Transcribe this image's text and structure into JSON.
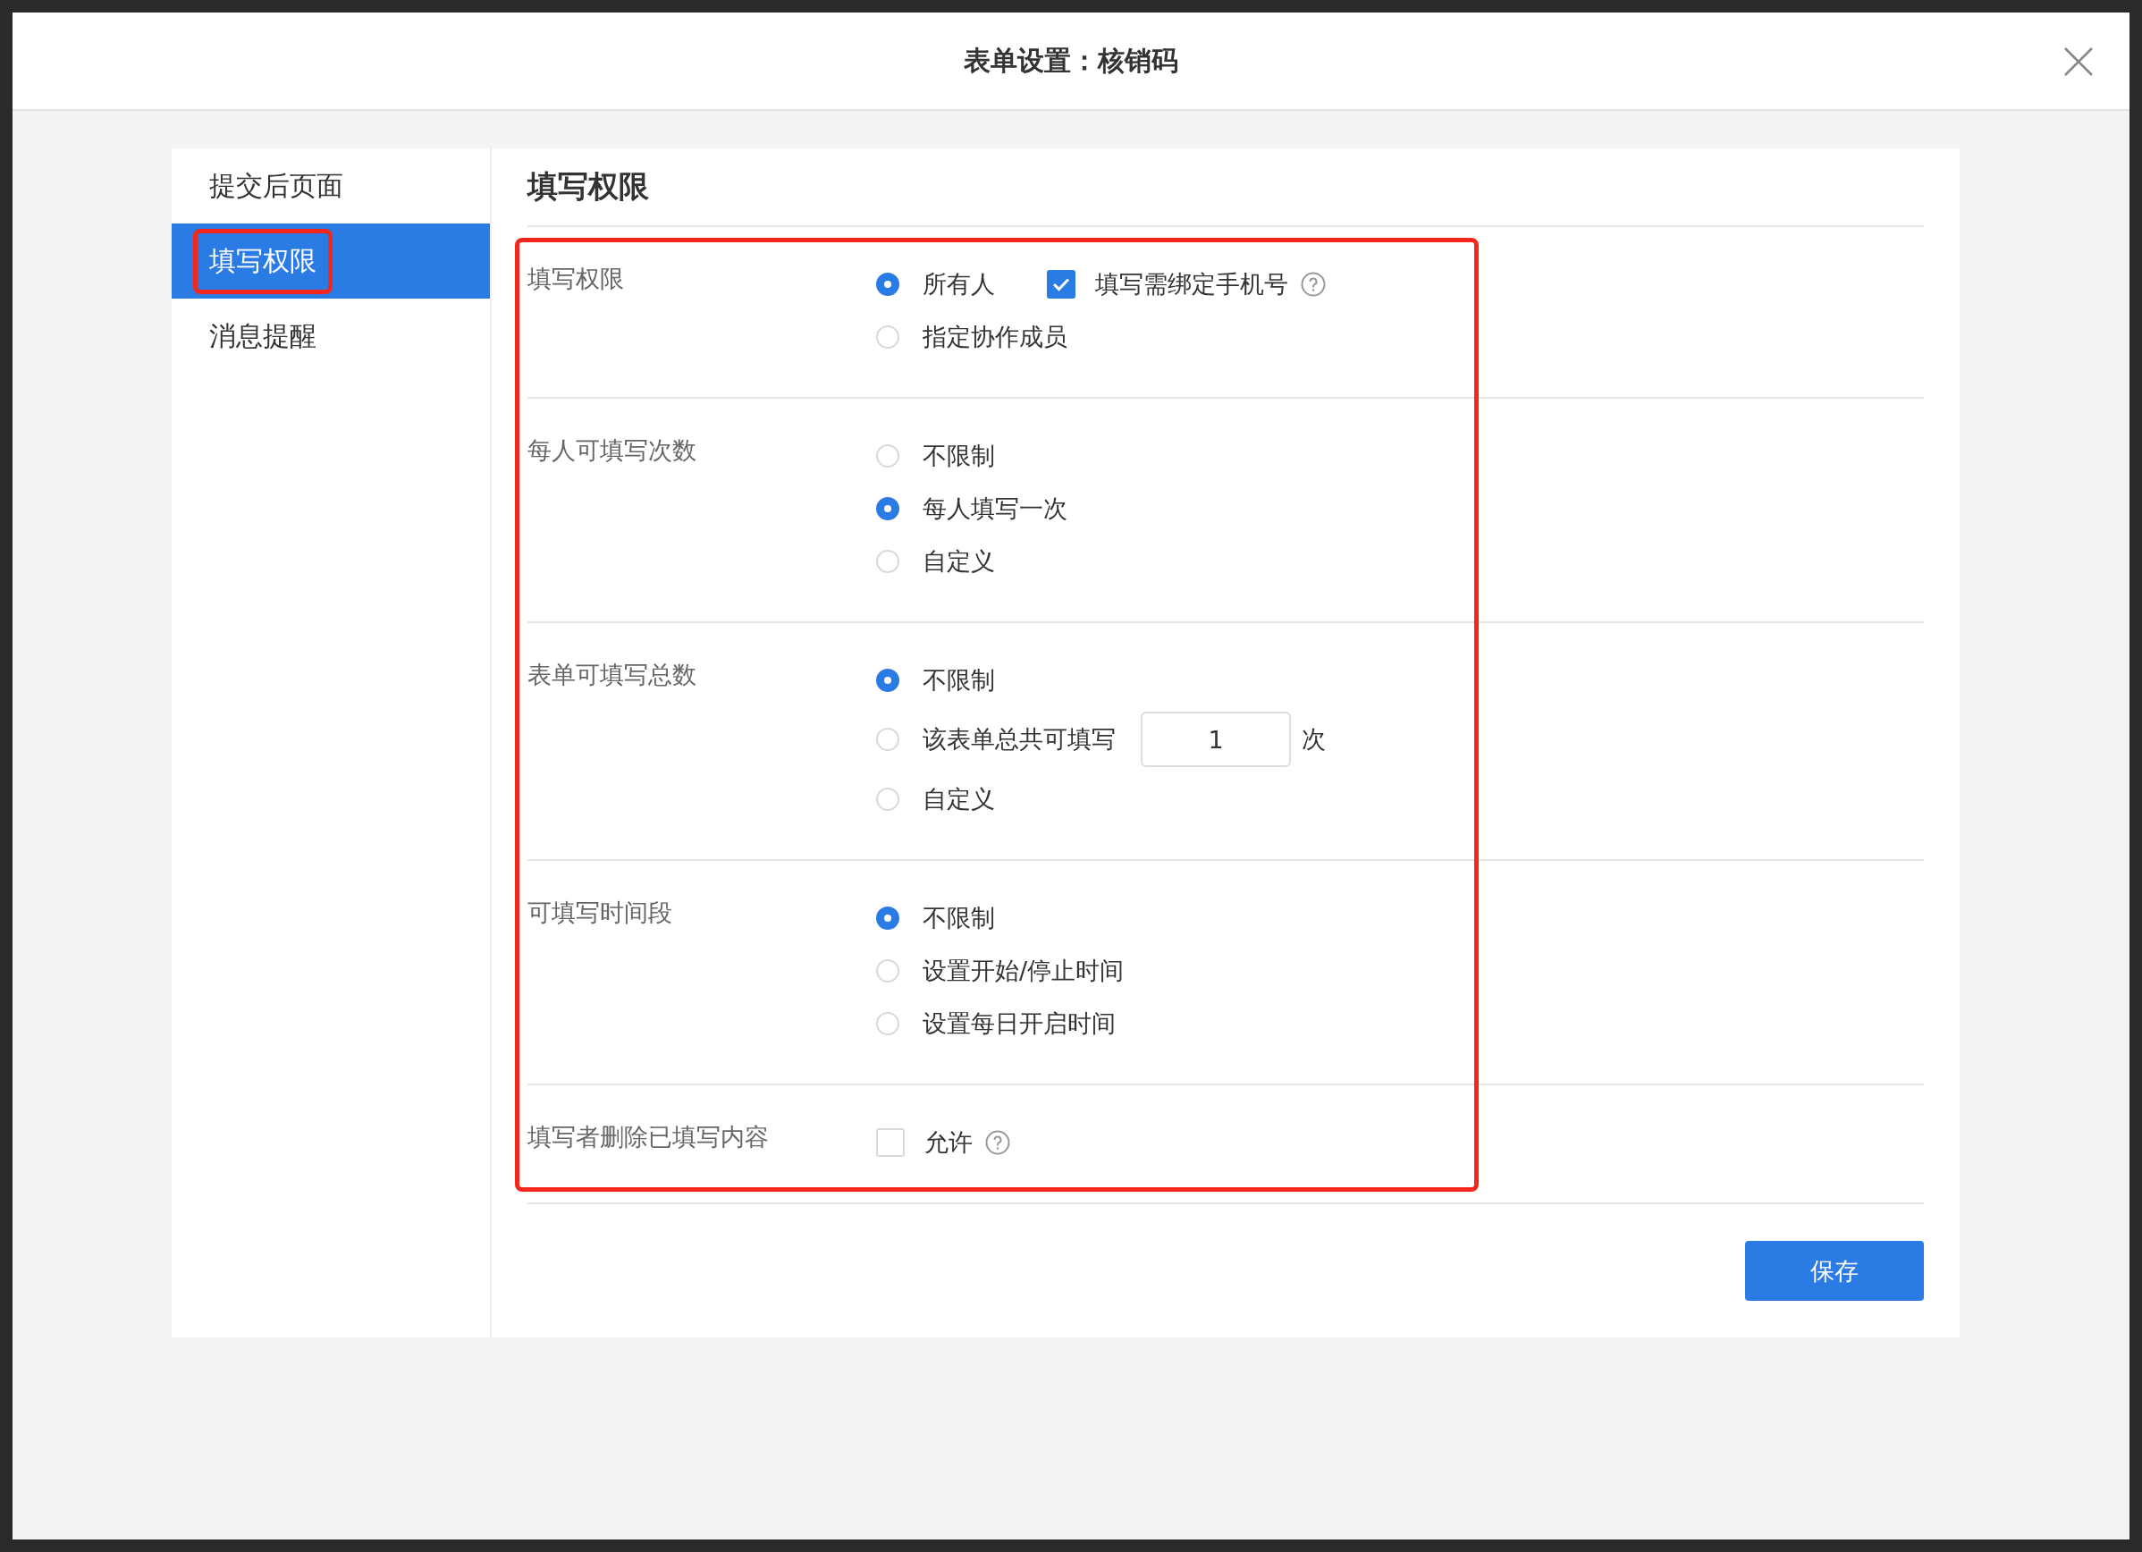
{
  "dialog": {
    "title": "表单设置：核销码"
  },
  "sidebar": {
    "items": [
      {
        "label": "提交后页面",
        "selected": false,
        "highlighted": false
      },
      {
        "label": "填写权限",
        "selected": true,
        "highlighted": true
      },
      {
        "label": "消息提醒",
        "selected": false,
        "highlighted": false
      }
    ]
  },
  "panel": {
    "title": "填写权限",
    "highlighted": true,
    "sections": [
      {
        "label": "填写权限",
        "rows": [
          [
            {
              "kind": "radio",
              "label": "所有人",
              "selected": true
            },
            {
              "kind": "checkbox",
              "label": "填写需绑定手机号",
              "checked": true,
              "help": true
            }
          ],
          [
            {
              "kind": "radio",
              "label": "指定协作成员",
              "selected": false
            }
          ]
        ]
      },
      {
        "label": "每人可填写次数",
        "rows": [
          [
            {
              "kind": "radio",
              "label": "不限制",
              "selected": false
            }
          ],
          [
            {
              "kind": "radio",
              "label": "每人填写一次",
              "selected": true
            }
          ],
          [
            {
              "kind": "radio",
              "label": "自定义",
              "selected": false
            }
          ]
        ]
      },
      {
        "label": "表单可填写总数",
        "rows": [
          [
            {
              "kind": "radio",
              "label": "不限制",
              "selected": true
            }
          ],
          [
            {
              "kind": "radio",
              "label": "该表单总共可填写",
              "selected": false
            },
            {
              "kind": "input",
              "value": "1"
            },
            {
              "kind": "text",
              "label": "次"
            }
          ],
          [
            {
              "kind": "radio",
              "label": "自定义",
              "selected": false
            }
          ]
        ]
      },
      {
        "label": "可填写时间段",
        "rows": [
          [
            {
              "kind": "radio",
              "label": "不限制",
              "selected": true
            }
          ],
          [
            {
              "kind": "radio",
              "label": "设置开始/停止时间",
              "selected": false
            }
          ],
          [
            {
              "kind": "radio",
              "label": "设置每日开启时间",
              "selected": false
            }
          ]
        ]
      },
      {
        "label": "填写者删除已填写内容",
        "rows": [
          [
            {
              "kind": "checkbox",
              "label": "允许",
              "checked": false,
              "help": true
            }
          ]
        ]
      }
    ]
  },
  "buttons": [
    {
      "label": "保存"
    }
  ]
}
